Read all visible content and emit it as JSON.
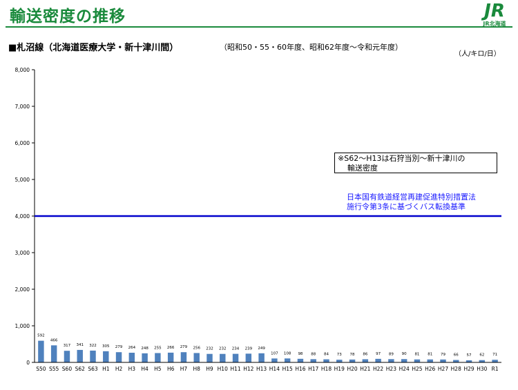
{
  "header": {
    "title": "輸送密度の推移",
    "logo_mark": "JR",
    "logo_text": "JR北海道"
  },
  "subtitle": {
    "main": "■札沼線（北海道医療大学・新十津川間）",
    "note": "（昭和50・55・60年度、昭和62年度～令和元年度）"
  },
  "unit_label": "（人/キロ/日）",
  "annotations": {
    "note_line1": "※S62～H13は石狩当別～新十津川の",
    "note_line2": "輸送密度",
    "threshold_line1": "日本国有鉄道経営再建促進特別措置法",
    "threshold_line2": "施行令第3条に基づくバス転換基準"
  },
  "colors": {
    "brand": "#1a8a3c",
    "bar": "#4f81bd",
    "threshold": "#0000cc",
    "threshold_text": "#1a1aff"
  },
  "chart_data": {
    "type": "bar",
    "categories": [
      "S50",
      "S55",
      "S60",
      "S62",
      "S63",
      "H1",
      "H2",
      "H3",
      "H4",
      "H5",
      "H6",
      "H7",
      "H8",
      "H9",
      "H10",
      "H11",
      "H12",
      "H13",
      "H14",
      "H15",
      "H16",
      "H17",
      "H18",
      "H19",
      "H20",
      "H21",
      "H22",
      "H23",
      "H24",
      "H25",
      "H26",
      "H27",
      "H28",
      "H29",
      "H30",
      "R1"
    ],
    "values": [
      592,
      466,
      317,
      341,
      322,
      305,
      279,
      264,
      248,
      255,
      266,
      279,
      256,
      232,
      232,
      234,
      239,
      249,
      107,
      108,
      98,
      88,
      84,
      73,
      78,
      86,
      97,
      89,
      90,
      81,
      81,
      79,
      66,
      57,
      62,
      71
    ],
    "ylim": [
      0,
      8000
    ],
    "yticks": [
      0,
      1000,
      2000,
      3000,
      4000,
      5000,
      6000,
      7000,
      8000
    ],
    "ytick_labels": [
      "0",
      "1,000",
      "2,000",
      "3,000",
      "4,000",
      "5,000",
      "6,000",
      "7,000",
      "8,000"
    ],
    "threshold": 4000,
    "grid": false,
    "data_labels": true
  }
}
